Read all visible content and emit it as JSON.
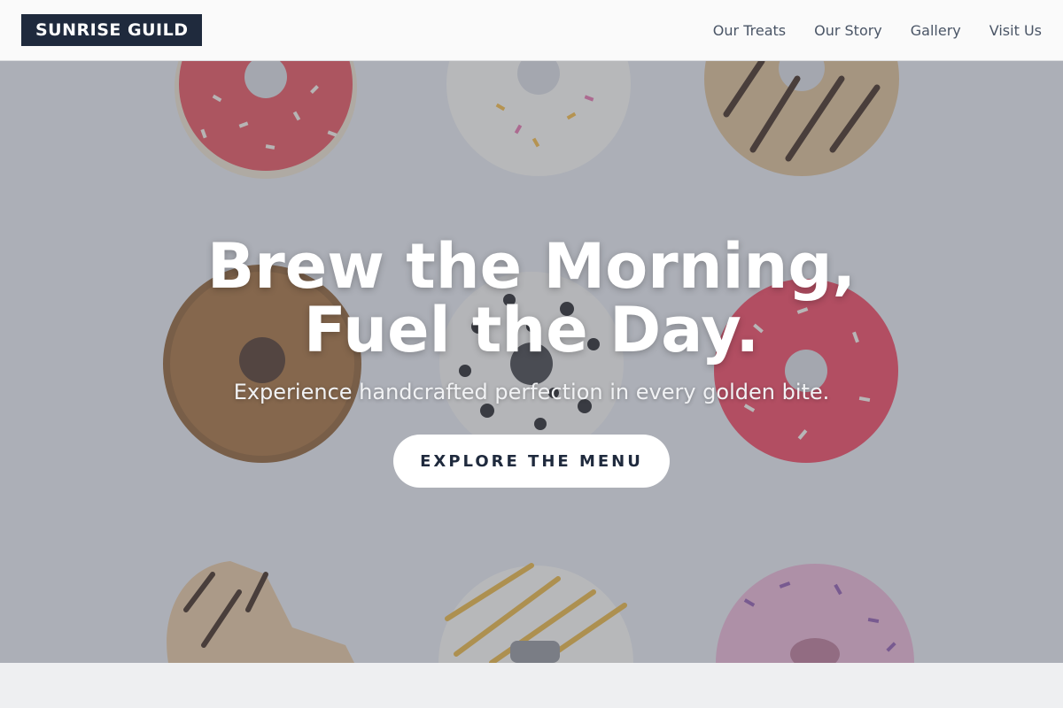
{
  "header": {
    "logo": "SUNRISE GUILD",
    "nav": [
      {
        "label": "Our Treats"
      },
      {
        "label": "Our Story"
      },
      {
        "label": "Gallery"
      },
      {
        "label": "Visit Us"
      }
    ]
  },
  "hero": {
    "title_line1": "Brew the Morning,",
    "title_line2": "Fuel the Day.",
    "subtitle": "Experience handcrafted perfection in every golden bite.",
    "cta_label": "EXPLORE THE MENU",
    "background": "donut-grid-photo"
  },
  "colors": {
    "brand": "#1f2a3d",
    "header_bg": "#fafafa",
    "nav_text": "#4a5566",
    "page_bg": "#eeeff1"
  }
}
